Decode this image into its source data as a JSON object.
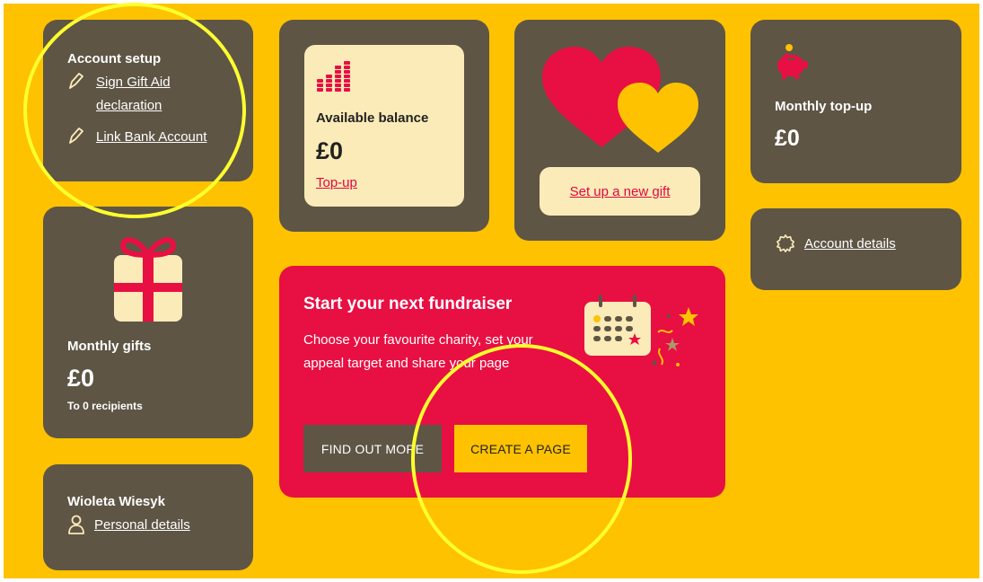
{
  "account_setup": {
    "title": "Account setup",
    "gift_aid_line1": "Sign Gift Aid",
    "gift_aid_line2": "declaration",
    "link_bank": "Link Bank Account",
    "icon": "pencil-icon"
  },
  "balance": {
    "label": "Available balance",
    "amount": "£0",
    "topup_link": "Top-up",
    "icon": "coin-stacks-icon"
  },
  "new_gift": {
    "button": "Set up a new gift",
    "icon": "hearts-icon"
  },
  "monthly_topup": {
    "label": "Monthly top-up",
    "amount": "£0",
    "icon": "piggy-bank-icon"
  },
  "account_details": {
    "link": "Account details",
    "icon": "gear-icon"
  },
  "monthly_gifts": {
    "label": "Monthly gifts",
    "amount": "£0",
    "recipients": "To 0 recipients",
    "icon": "gift-box-icon"
  },
  "profile": {
    "name": "Wioleta Wiesyk",
    "link": "Personal details",
    "icon": "person-icon"
  },
  "fundraiser": {
    "heading": "Start your next fundraiser",
    "body": "Choose your favourite charity, set your appeal target and share your page",
    "find_out_more": "FIND OUT MORE",
    "create_page": "CREATE A PAGE",
    "icon": "calendar-confetti-icon"
  },
  "colors": {
    "background": "#FEC200",
    "card": "#5E5545",
    "accent_red": "#E80F43",
    "cream": "#FBEBB8",
    "highlight_circle": "#FFFF2E"
  }
}
